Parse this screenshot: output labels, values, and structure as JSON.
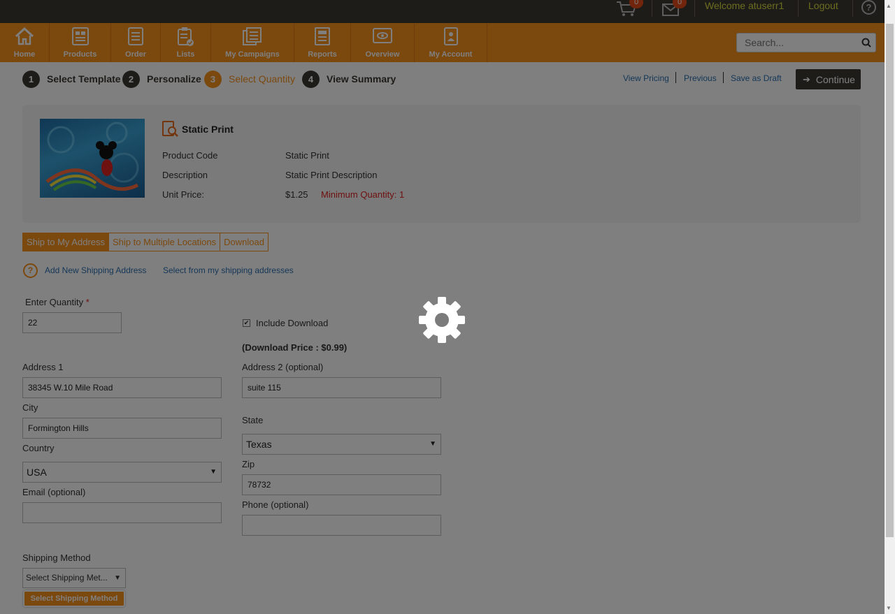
{
  "topbar": {
    "cart_count": "0",
    "messages_count": "0",
    "welcome": "Welcome atuserr1",
    "logout": "Logout",
    "help": "?"
  },
  "nav": {
    "items": [
      {
        "label": "Home",
        "icon": "home-icon"
      },
      {
        "label": "Products",
        "icon": "products-icon"
      },
      {
        "label": "Order",
        "icon": "order-icon"
      },
      {
        "label": "Lists",
        "icon": "lists-icon"
      },
      {
        "label": "My Campaigns",
        "icon": "campaigns-icon"
      },
      {
        "label": "Reports",
        "icon": "reports-icon"
      },
      {
        "label": "Overview",
        "icon": "overview-icon"
      },
      {
        "label": "My Account",
        "icon": "account-icon"
      }
    ],
    "search_placeholder": "Search..."
  },
  "steps": [
    {
      "num": "1",
      "label": "Select Template"
    },
    {
      "num": "2",
      "label": "Personalize"
    },
    {
      "num": "3",
      "label": "Select Quantity"
    },
    {
      "num": "4",
      "label": "View Summary"
    }
  ],
  "actions": {
    "view_pricing": "View Pricing",
    "previous": "Previous",
    "save_draft": "Save as Draft",
    "continue": "Continue"
  },
  "product": {
    "title": "Static Print",
    "code_label": "Product Code",
    "code_value": "Static Print",
    "desc_label": "Description",
    "desc_value": "Static Print Description",
    "price_label": "Unit Price:",
    "price_value": "$1.25",
    "min_qty": "Minimum Quantity: 1"
  },
  "tabs": [
    {
      "label": "Ship to My Address"
    },
    {
      "label": "Ship to Multiple Locations"
    },
    {
      "label": "Download"
    }
  ],
  "address_links": {
    "add_new": "Add New Shipping Address",
    "select_from": "Select from my shipping addresses"
  },
  "form": {
    "quantity_label": "Enter Quantity",
    "quantity_required": "*",
    "quantity_value": "22",
    "include_download": "Include Download",
    "download_price": "(Download Price : $0.99)",
    "address1_label": "Address 1",
    "address1_value": "38345 W.10 Mile Road",
    "address2_label": "Address 2 (optional)",
    "address2_value": "suite 115",
    "city_label": "City",
    "city_value": "Formington Hills",
    "state_label": "State",
    "state_value": "Texas",
    "country_label": "Country",
    "country_value": "USA",
    "zip_label": "Zip",
    "zip_value": "78732",
    "email_label": "Email (optional)",
    "email_value": "",
    "phone_label": "Phone (optional)",
    "phone_value": "",
    "shipping_method_label": "Shipping Method",
    "shipping_method_value": "Select Shipping Met...",
    "shipping_method_button": "Select Shipping Method"
  },
  "colors": {
    "brand_orange": "#f7911d",
    "dark": "#3d3833",
    "link_blue": "#2a6fb0",
    "error_red": "#dd2222"
  }
}
